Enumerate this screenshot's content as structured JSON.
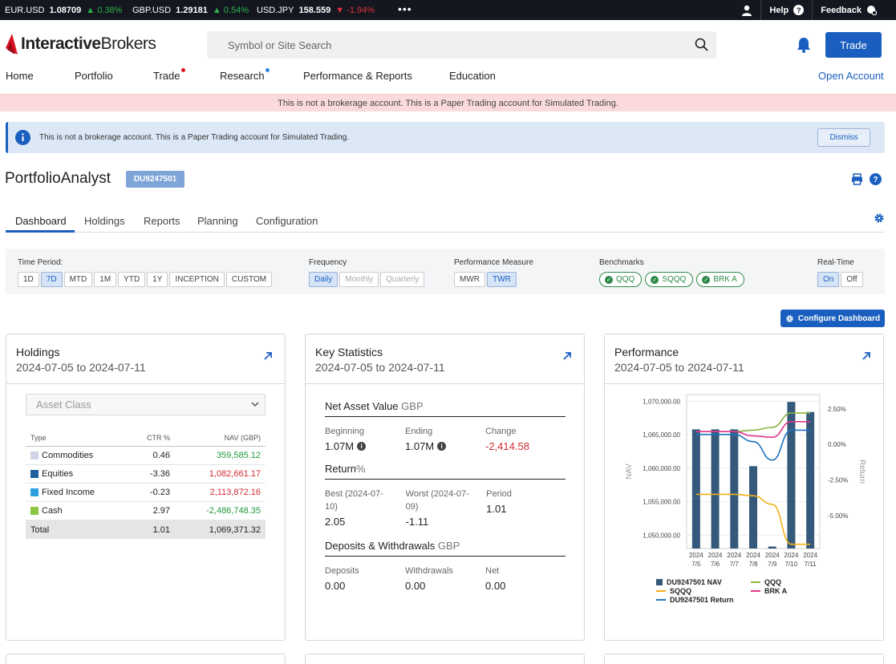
{
  "ticker": [
    {
      "symbol": "EUR.USD",
      "price": "1.08709",
      "change": "▲ 0.38%",
      "dir": "up"
    },
    {
      "symbol": "GBP.USD",
      "price": "1.29181",
      "change": "▲ 0.54%",
      "dir": "up"
    },
    {
      "symbol": "USD.JPY",
      "price": "158.559",
      "change": "▼ -1.94%",
      "dir": "down"
    }
  ],
  "ticker_more": "•••",
  "topbar": {
    "help": "Help",
    "feedback": "Feedback"
  },
  "logo": {
    "part1": "Interactive",
    "part2": "Brokers"
  },
  "search": {
    "placeholder": "Symbol or Site Search"
  },
  "trade_button": "Trade",
  "nav": {
    "items": [
      "Home",
      "Portfolio",
      "Trade",
      "Research",
      "Performance & Reports",
      "Education"
    ],
    "open_account": "Open Account"
  },
  "paper_banner": "This is not a brokerage account. This is a Paper Trading account for Simulated Trading.",
  "info_box": {
    "message": "This is not a brokerage account. This is a Paper Trading account for Simulated Trading.",
    "dismiss": "Dismiss"
  },
  "page": {
    "title": "PortfolioAnalyst",
    "account": "DU9247501"
  },
  "tabs": [
    "Dashboard",
    "Holdings",
    "Reports",
    "Planning",
    "Configuration"
  ],
  "filters": {
    "time_period": {
      "label": "Time Period:",
      "options": [
        "1D",
        "7D",
        "MTD",
        "1M",
        "YTD",
        "1Y",
        "INCEPTION",
        "CUSTOM"
      ],
      "selected": "7D"
    },
    "frequency": {
      "label": "Frequency",
      "options": [
        "Daily",
        "Monthly",
        "Quarterly"
      ],
      "selected": "Daily"
    },
    "performance_measure": {
      "label": "Performance Measure",
      "options": [
        "MWR",
        "TWR"
      ],
      "selected": "TWR"
    },
    "benchmarks": {
      "label": "Benchmarks",
      "options": [
        "QQQ",
        "SQQQ",
        "BRK A"
      ]
    },
    "realtime": {
      "label": "Real-Time",
      "options": [
        "On",
        "Off"
      ],
      "selected": "On"
    }
  },
  "configure_dashboard": "Configure Dashboard",
  "holdings": {
    "title": "Holdings",
    "range": "2024-07-05 to 2024-07-11",
    "select_placeholder": "Asset Class",
    "headers": [
      "Type",
      "CTR %",
      "NAV (GBP)"
    ],
    "rows": [
      {
        "type": "Commodities",
        "ctr": "0.46",
        "nav": "359,585.12",
        "color": "#d0d3e6",
        "sign": "pos"
      },
      {
        "type": "Equities",
        "ctr": "-3.36",
        "nav": "1,082,661.17",
        "color": "#1f5f9b",
        "sign": "neg"
      },
      {
        "type": "Fixed Income",
        "ctr": "-0.23",
        "nav": "2,113,872.16",
        "color": "#2e9fe0",
        "sign": "neg"
      },
      {
        "type": "Cash",
        "ctr": "2.97",
        "nav": "-2,486,748.35",
        "color": "#8cc63f",
        "sign": "pos"
      }
    ],
    "total": {
      "type": "Total",
      "ctr": "1.01",
      "nav": "1,069,371.32"
    }
  },
  "key_stats": {
    "title": "Key Statistics",
    "range": "2024-07-05 to 2024-07-11",
    "nav": {
      "heading": "Net Asset Value",
      "currency": "GBP",
      "beginning_label": "Beginning",
      "beginning": "1.07M",
      "ending_label": "Ending",
      "ending": "1.07M",
      "change_label": "Change",
      "change": "-2,414.58"
    },
    "return": {
      "heading": "Return",
      "unit": "%",
      "best_label": "Best (2024-07-10)",
      "best": "2.05",
      "worst_label": "Worst (2024-07-09)",
      "worst": "-1.11",
      "period_label": "Period",
      "period": "1.01"
    },
    "deposits": {
      "heading": "Deposits & Withdrawals",
      "currency": "GBP",
      "deposits_label": "Deposits",
      "deposits": "0.00",
      "withdrawals_label": "Withdrawals",
      "withdrawals": "0.00",
      "net_label": "Net",
      "net": "0.00"
    }
  },
  "performance": {
    "title": "Performance",
    "range": "2024-07-05 to 2024-07-11"
  },
  "chart_data": {
    "type": "bar",
    "categories": [
      "2024 7/5",
      "2024 7/6",
      "2024 7/7",
      "2024 7/8",
      "2024 7/9",
      "2024 7/10",
      "2024 7/11"
    ],
    "ylabel": "NAV",
    "y2label": "Return",
    "ylim": [
      1048000,
      1071000
    ],
    "y_ticks": [
      "1,050,000.00",
      "1,055,000.00",
      "1,060,000.00",
      "1,065,000.00",
      "1,070,000.00"
    ],
    "y2lim": [
      -7.3,
      3.5
    ],
    "y2_ticks": [
      "2.50%",
      "0.00%",
      "-2.50%",
      "-5.00%"
    ],
    "series": [
      {
        "name": "DU9247501 NAV",
        "kind": "bar",
        "color": "#35597a",
        "values": [
          1065800,
          1065800,
          1065800,
          1060300,
          1048300,
          1069900,
          1068400
        ]
      },
      {
        "name": "QQQ",
        "kind": "line",
        "color": "#8ab544",
        "values": [
          0.9,
          0.9,
          0.9,
          1.0,
          1.2,
          2.2,
          2.2
        ]
      },
      {
        "name": "SQQQ",
        "kind": "line",
        "color": "#f2b21a",
        "values": [
          -3.5,
          -3.5,
          -3.5,
          -3.6,
          -4.2,
          -7.0,
          -7.0
        ]
      },
      {
        "name": "BRK A",
        "kind": "line",
        "color": "#e0378a",
        "values": [
          0.9,
          0.9,
          0.9,
          0.6,
          0.5,
          1.6,
          1.6
        ]
      },
      {
        "name": "DU9247501 Return",
        "kind": "line",
        "color": "#1e73be",
        "values": [
          0.7,
          0.7,
          0.7,
          0.2,
          -1.1,
          1.0,
          1.0
        ]
      }
    ],
    "legend_position": "bottom"
  }
}
